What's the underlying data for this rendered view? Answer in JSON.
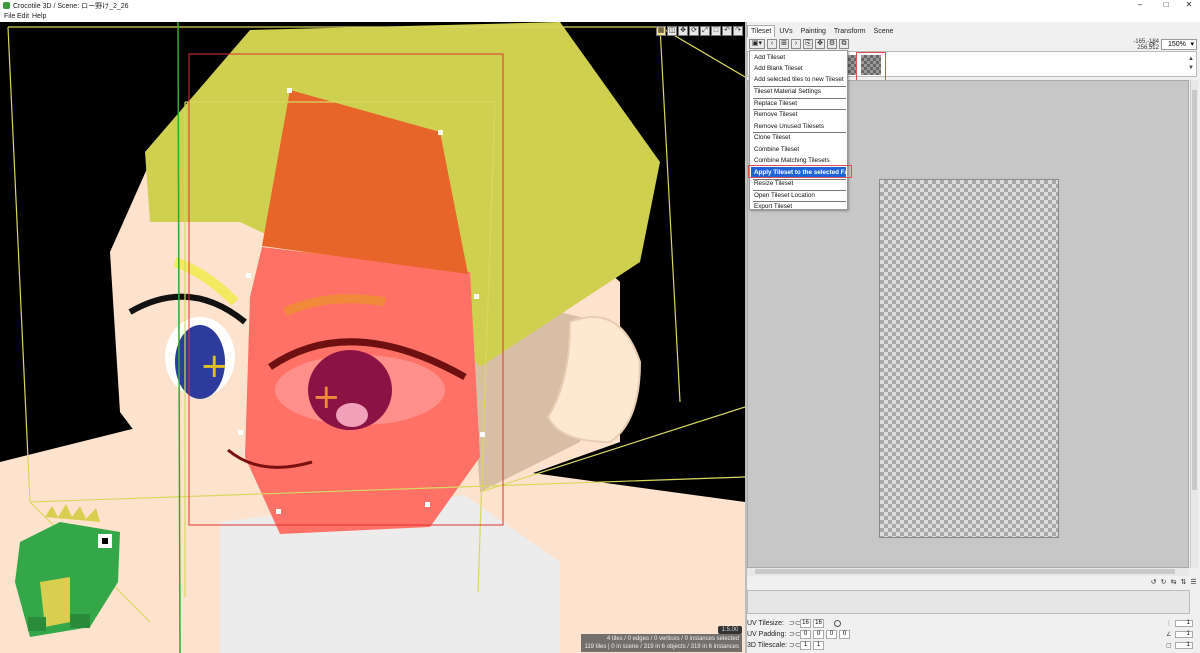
{
  "window": {
    "title": "Crocotile 3D / Scene: ロー野け_2_26",
    "controls": [
      "–",
      "□",
      "✕"
    ]
  },
  "menubar": {
    "items": [
      "File",
      "Edit",
      "Help"
    ]
  },
  "viewport": {
    "tool_icons": [
      "grid-icon",
      "cube-icon",
      "move-icon",
      "rotate-icon",
      "scale-icon",
      "frame-icon",
      "undo-icon",
      "redo-icon"
    ],
    "zoom_badge": "1:5.00",
    "status_line1": "4 tiles / 0 edges / 0 vertices / 0 instances selected",
    "status_line2": "119 tiles | 0 in scene / 319 in 6 objects / 319 in 6 instances"
  },
  "panel": {
    "tabs": [
      "Tileset",
      "UVs",
      "Painting",
      "Transform",
      "Scene"
    ],
    "active_tab": "Tileset",
    "coords_line1": "-165,-184",
    "coords_line2": "256,512",
    "zoom": "150%",
    "toolbar_glyphs": [
      "▣▾",
      "‹",
      "⊞",
      "›",
      "⎘",
      "✥",
      "⚙",
      "⧉"
    ]
  },
  "tileset_menu": {
    "items": [
      "Add Tileset",
      "Add Blank Tileset",
      "Add selected tiles to new Tileset",
      "Tileset Material Settings",
      "Replace Tileset",
      "Remove Tileset",
      "Remove Unused Tilesets",
      "Clone Tileset",
      "Combine Tileset",
      "Combine Matching Tilesets",
      "Apply Tileset to the selected Faces",
      "Resize Tileset",
      "Open Tileset Location",
      "Export Tileset"
    ],
    "selected_index": 10
  },
  "properties": {
    "uv_tilesize": {
      "label": "UV Tilesize:",
      "values": [
        "16",
        "16"
      ]
    },
    "uv_padding": {
      "label": "UV Padding:",
      "values": [
        "0",
        "0",
        "0",
        "0"
      ]
    },
    "tilescale_3d": {
      "label": "3D Tilescale:",
      "values": [
        "1",
        "1"
      ]
    },
    "right_values": [
      "1",
      "1",
      "1"
    ]
  },
  "colors": {
    "hair": "#cfcf50",
    "skin": "#fde3cd",
    "face_selection": "#ff7066",
    "orange_face": "#e8652a",
    "menu_highlight": "#1f63d6",
    "selection_box": "#e05050"
  }
}
